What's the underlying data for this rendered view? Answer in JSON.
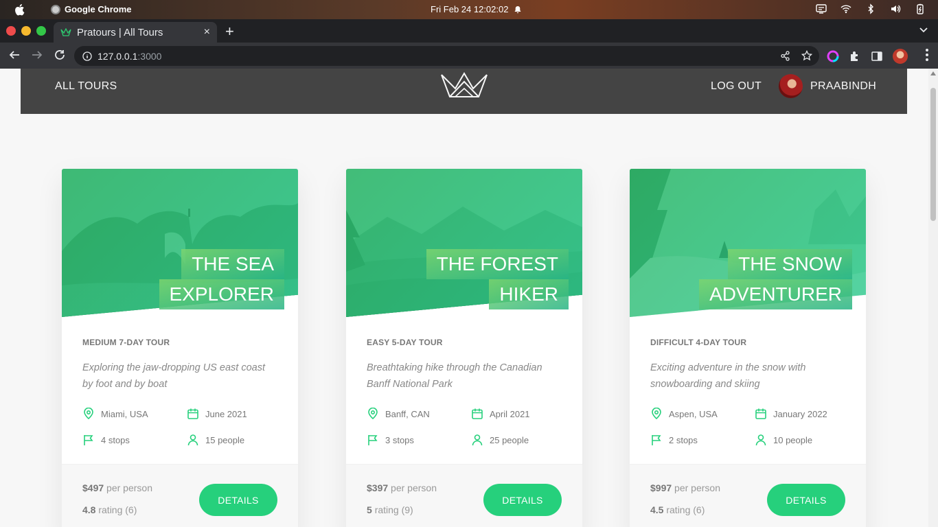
{
  "os": {
    "app_name": "Google Chrome",
    "datetime": "Fri Feb 24  12:02:02"
  },
  "browser": {
    "tab_title": "Pratours | All Tours",
    "url_host": "127.0.0.1",
    "url_port": ":3000",
    "new_tab_label": "+",
    "close_tab_label": "×"
  },
  "header": {
    "all_tours": "ALL TOURS",
    "logout": "LOG OUT",
    "user_name": "PRAABINDH"
  },
  "colors": {
    "accent": "#26d07c",
    "header_bg": "#444444",
    "page_bg": "#f7f7f7"
  },
  "tours": [
    {
      "title_line1": "THE SEA",
      "title_line2": "EXPLORER",
      "subheading": "MEDIUM 7-DAY TOUR",
      "summary": "Exploring the jaw-dropping US east coast by foot and by boat",
      "location": "Miami, USA",
      "date": "June 2021",
      "stops": "4 stops",
      "people": "15 people",
      "price": "$497",
      "price_unit": "per person",
      "rating": "4.8",
      "rating_text": "rating (6)",
      "button": "DETAILS"
    },
    {
      "title_line1": "THE FOREST",
      "title_line2": "HIKER",
      "subheading": "EASY 5-DAY TOUR",
      "summary": "Breathtaking hike through the Canadian Banff National Park",
      "location": "Banff, CAN",
      "date": "April 2021",
      "stops": "3 stops",
      "people": "25 people",
      "price": "$397",
      "price_unit": "per person",
      "rating": "5",
      "rating_text": "rating (9)",
      "button": "DETAILS"
    },
    {
      "title_line1": "THE SNOW",
      "title_line2": "ADVENTURER",
      "subheading": "DIFFICULT 4-DAY TOUR",
      "summary": "Exciting adventure in the snow with snowboarding and skiing",
      "location": "Aspen, USA",
      "date": "January 2022",
      "stops": "2 stops",
      "people": "10 people",
      "price": "$997",
      "price_unit": "per person",
      "rating": "4.5",
      "rating_text": "rating (6)",
      "button": "DETAILS"
    }
  ]
}
